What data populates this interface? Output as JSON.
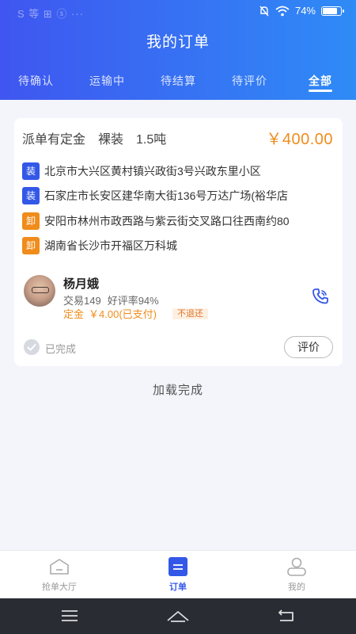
{
  "status_bar": {
    "left_text": "S 等 ⊞ ⓢ ···",
    "battery_text": "74%",
    "battery_level": 0.74
  },
  "header": {
    "title": "我的订单",
    "tabs": [
      {
        "label": "待确认",
        "active": false
      },
      {
        "label": "运输中",
        "active": false
      },
      {
        "label": "待结算",
        "active": false
      },
      {
        "label": "待评价",
        "active": false
      },
      {
        "label": "全部",
        "active": true
      }
    ]
  },
  "order": {
    "dispatch_type": "派单有定金",
    "cargo_type": "裸装",
    "weight": "1.5吨",
    "price": "￥400.00",
    "addresses": [
      {
        "tag": "装",
        "kind": "load",
        "text": "北京市大兴区黄村镇兴政街3号兴政东里小区"
      },
      {
        "tag": "装",
        "kind": "load",
        "text": "石家庄市长安区建华南大街136号万达广场(裕华店"
      },
      {
        "tag": "卸",
        "kind": "unload",
        "text": "安阳市林州市政西路与紫云街交叉路口往西南约80"
      },
      {
        "tag": "卸",
        "kind": "unload",
        "text": "湖南省长沙市开福区万科城"
      }
    ],
    "driver": {
      "name": "杨月娥",
      "trades": "交易149",
      "rating": "好评率94%",
      "deposit_label": "定金",
      "deposit_amount": "￥4.00(已支付)",
      "refund_badge": "不退还"
    },
    "status": "已完成",
    "review_button": "评价"
  },
  "load_complete": "加载完成",
  "bottom_nav": [
    {
      "label": "抢单大厅",
      "icon": "home-icon",
      "active": false
    },
    {
      "label": "订单",
      "icon": "order-list-icon",
      "active": true
    },
    {
      "label": "我的",
      "icon": "user-icon",
      "active": false
    }
  ],
  "colors": {
    "brand_blue": "#3358e8",
    "accent_orange": "#f08c1b",
    "header_gradient": [
      "#3f56f0",
      "#2f8bf6"
    ]
  }
}
